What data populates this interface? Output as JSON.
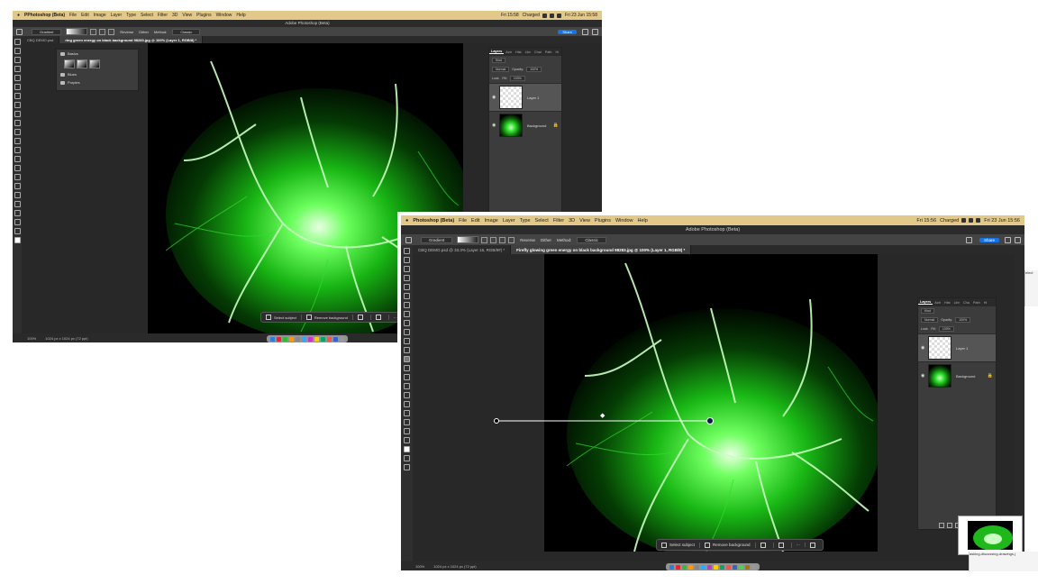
{
  "menubar1": {
    "app": "PPhotoshop (Beta)",
    "items": [
      "File",
      "Edit",
      "Image",
      "Layer",
      "Type",
      "Select",
      "Filter",
      "3D",
      "View",
      "Plugins",
      "Window",
      "Help"
    ],
    "time": "Fri 15:58",
    "battery": "Charged",
    "date": "Fri 23 Jun 15:58"
  },
  "menubar2": {
    "app": "Photoshop (Beta)",
    "items": [
      "File",
      "Edit",
      "Image",
      "Layer",
      "Type",
      "Select",
      "Filter",
      "3D",
      "View",
      "Plugins",
      "Window",
      "Help"
    ],
    "time": "Fri 15:56",
    "battery": "Charged",
    "date": "Fri 23 Jun 15:56"
  },
  "window_title": "Adobe Photoshop (Beta)",
  "options": {
    "tool_preset": "Gradient",
    "reverse": "Reverse",
    "dither": "Dither",
    "method_label": "Method:",
    "method": "Classic",
    "share": "Share"
  },
  "tabs1": [
    {
      "label": "CBQ DEMO.psd"
    },
    {
      "label": "ring green energy on black background 98283.jpg @ 100% (Layer 1, RGB/8) *"
    }
  ],
  "tabs2": [
    {
      "label": "CBQ DEMO.psd @ 33.3% (Layer 16, RGB/8#) *"
    },
    {
      "label": "Firefly glowing green energy on black background 98283.jpg @ 100% (Layer 1, RGB/8) *"
    }
  ],
  "history": {
    "basics": "Basics",
    "blues": "Blues",
    "purples": "Purples"
  },
  "layers_panel": {
    "tabs": [
      "Layers",
      "Actr",
      "Hist",
      "Libr",
      "Chai",
      "Path",
      "Hi"
    ],
    "tabs2": [
      "Layers",
      "Actr",
      "Hist",
      "Libr",
      "Cha",
      "Path",
      "Hi"
    ],
    "kind": "Kind",
    "blend": "Normal",
    "opacity_label": "Opacity:",
    "opacity": "100%",
    "lock_label": "Lock:",
    "fill_label": "Fill:",
    "fill": "100%",
    "layers": [
      {
        "name": "Layer 1",
        "selected": true
      },
      {
        "name": "Background",
        "selected": false
      }
    ]
  },
  "context_bar": {
    "select_subject": "Select subject",
    "remove_background": "Remove background"
  },
  "status1": {
    "zoom": "100%",
    "size": "1024 px x 1024 px (72 ppi)"
  },
  "status2": {
    "zoom": "100%",
    "size": "1024 px x 1024 px (72 ppi)"
  },
  "side_text": {
    "a": "elect",
    "b": "elect",
    "c": "asking-discussing-drawings.j"
  },
  "colors": {
    "menubar": "#e2c98a",
    "glow": "#2fe02b",
    "share": "#1473e6"
  }
}
